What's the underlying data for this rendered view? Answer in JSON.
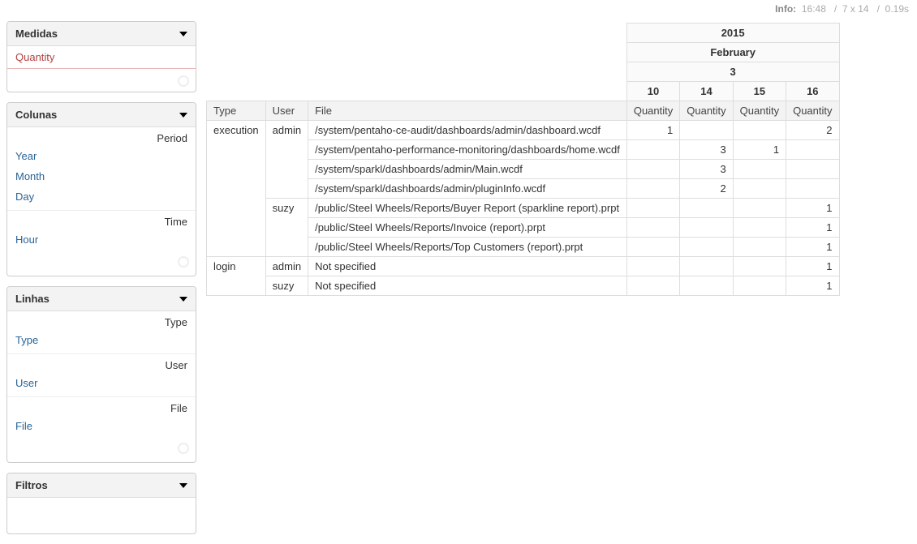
{
  "info": {
    "label": "Info:",
    "time": "16:48",
    "dims": "7 x 14",
    "duration": "0.19s",
    "sep": "/"
  },
  "panels": {
    "medidas": {
      "title": "Medidas",
      "items": [
        "Quantity"
      ]
    },
    "colunas": {
      "title": "Colunas",
      "groups": [
        {
          "label": "Period",
          "items": [
            "Year",
            "Month",
            "Day"
          ]
        },
        {
          "label": "Time",
          "items": [
            "Hour"
          ]
        }
      ]
    },
    "linhas": {
      "title": "Linhas",
      "groups": [
        {
          "label": "Type",
          "items": [
            "Type"
          ]
        },
        {
          "label": "User",
          "items": [
            "User"
          ]
        },
        {
          "label": "File",
          "items": [
            "File"
          ]
        }
      ]
    },
    "filtros": {
      "title": "Filtros"
    }
  },
  "pivot": {
    "colHeaders": {
      "year": "2015",
      "month": "February",
      "day": "3",
      "hours": [
        "10",
        "14",
        "15",
        "16"
      ],
      "measure": "Quantity"
    },
    "rowDimLabels": {
      "type": "Type",
      "user": "User",
      "file": "File"
    },
    "rows": [
      {
        "type": "execution",
        "user": "admin",
        "file": "/system/pentaho-ce-audit/dashboards/admin/dashboard.wcdf",
        "vals": [
          "1",
          "",
          "",
          "2"
        ]
      },
      {
        "type": "",
        "user": "",
        "file": "/system/pentaho-performance-monitoring/dashboards/home.wcdf",
        "vals": [
          "",
          "3",
          "1",
          ""
        ]
      },
      {
        "type": "",
        "user": "",
        "file": "/system/sparkl/dashboards/admin/Main.wcdf",
        "vals": [
          "",
          "3",
          "",
          ""
        ]
      },
      {
        "type": "",
        "user": "",
        "file": "/system/sparkl/dashboards/admin/pluginInfo.wcdf",
        "vals": [
          "",
          "2",
          "",
          ""
        ]
      },
      {
        "type": "",
        "user": "suzy",
        "file": "/public/Steel Wheels/Reports/Buyer Report (sparkline report).prpt",
        "vals": [
          "",
          "",
          "",
          "1"
        ]
      },
      {
        "type": "",
        "user": "",
        "file": "/public/Steel Wheels/Reports/Invoice (report).prpt",
        "vals": [
          "",
          "",
          "",
          "1"
        ]
      },
      {
        "type": "",
        "user": "",
        "file": "/public/Steel Wheels/Reports/Top Customers (report).prpt",
        "vals": [
          "",
          "",
          "",
          "1"
        ]
      },
      {
        "type": "login",
        "user": "admin",
        "file": "Not specified",
        "vals": [
          "",
          "",
          "",
          "1"
        ]
      },
      {
        "type": "",
        "user": "suzy",
        "file": "Not specified",
        "vals": [
          "",
          "",
          "",
          "1"
        ]
      }
    ]
  }
}
